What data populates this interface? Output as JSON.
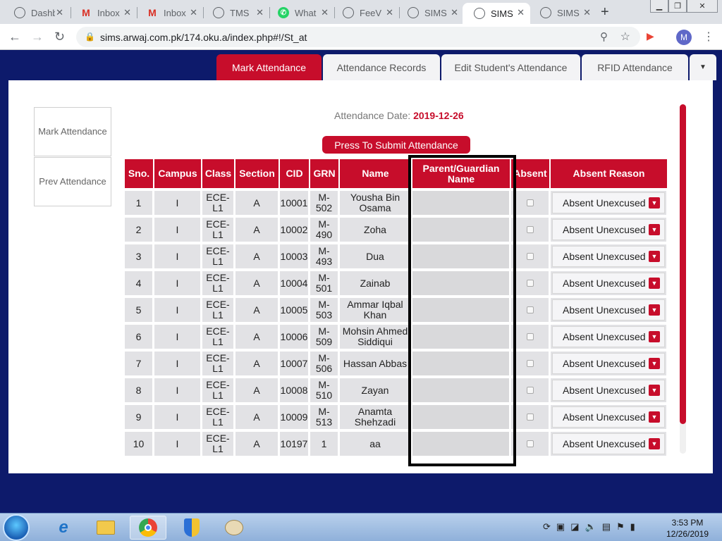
{
  "browser": {
    "tabs": [
      {
        "title": "Dashb",
        "icon": "globe-icon"
      },
      {
        "title": "Inbox",
        "icon": "gmail-icon"
      },
      {
        "title": "Inbox",
        "icon": "gmail-icon"
      },
      {
        "title": "TMS",
        "icon": "globe-icon"
      },
      {
        "title": "What",
        "icon": "whatsapp-icon"
      },
      {
        "title": "FeeV",
        "icon": "globe-icon"
      },
      {
        "title": "SIMS",
        "icon": "globe-icon"
      },
      {
        "title": "SIMS",
        "icon": "globe-icon",
        "active": true
      },
      {
        "title": "SIMS",
        "icon": "globe-icon"
      }
    ],
    "url": "sims.arwaj.com.pk/174.oku.a/index.php#!/St_at",
    "profile_initial": "M"
  },
  "page_tabs": [
    {
      "label": "Mark Attendance",
      "active": true
    },
    {
      "label": "Attendance Records"
    },
    {
      "label": "Edit Student's Attendance"
    },
    {
      "label": "RFID Attendance"
    }
  ],
  "sidebar": {
    "mark_attendance": "Mark Attendance",
    "prev_attendance": "Prev Attendance"
  },
  "attendance": {
    "date_label": "Attendance Date:",
    "date_value": "2019-12-26",
    "submit_label": "Press To Submit Attendance",
    "columns": [
      "Sno.",
      "Campus",
      "Class",
      "Section",
      "CID",
      "GRN",
      "Name",
      "Parent/Guardian Name",
      "Absent",
      "Absent Reason"
    ],
    "rows": [
      {
        "sno": "1",
        "campus": "I",
        "class": "ECE-L1",
        "section": "A",
        "cid": "10001",
        "grn": "M-502",
        "name": "Yousha Bin Osama",
        "guardian": "",
        "reason": "Absent Unexcused"
      },
      {
        "sno": "2",
        "campus": "I",
        "class": "ECE-L1",
        "section": "A",
        "cid": "10002",
        "grn": "M-490",
        "name": "Zoha",
        "guardian": "",
        "reason": "Absent Unexcused"
      },
      {
        "sno": "3",
        "campus": "I",
        "class": "ECE-L1",
        "section": "A",
        "cid": "10003",
        "grn": "M-493",
        "name": "Dua",
        "guardian": "",
        "reason": "Absent Unexcused"
      },
      {
        "sno": "4",
        "campus": "I",
        "class": "ECE-L1",
        "section": "A",
        "cid": "10004",
        "grn": "M-501",
        "name": "Zainab",
        "guardian": "",
        "reason": "Absent Unexcused"
      },
      {
        "sno": "5",
        "campus": "I",
        "class": "ECE-L1",
        "section": "A",
        "cid": "10005",
        "grn": "M-503",
        "name": "Ammar Iqbal Khan",
        "guardian": "",
        "reason": "Absent Unexcused"
      },
      {
        "sno": "6",
        "campus": "I",
        "class": "ECE-L1",
        "section": "A",
        "cid": "10006",
        "grn": "M-509",
        "name": "Mohsin Ahmed Siddiqui",
        "guardian": "",
        "reason": "Absent Unexcused"
      },
      {
        "sno": "7",
        "campus": "I",
        "class": "ECE-L1",
        "section": "A",
        "cid": "10007",
        "grn": "M-506",
        "name": "Hassan Abbas",
        "guardian": "",
        "reason": "Absent Unexcused"
      },
      {
        "sno": "8",
        "campus": "I",
        "class": "ECE-L1",
        "section": "A",
        "cid": "10008",
        "grn": "M-510",
        "name": "Zayan",
        "guardian": "",
        "reason": "Absent Unexcused"
      },
      {
        "sno": "9",
        "campus": "I",
        "class": "ECE-L1",
        "section": "A",
        "cid": "10009",
        "grn": "M-513",
        "name": "Anamta Shehzadi",
        "guardian": "",
        "reason": "Absent Unexcused"
      },
      {
        "sno": "10",
        "campus": "I",
        "class": "ECE-L1",
        "section": "A",
        "cid": "10197",
        "grn": "1",
        "name": "aa",
        "guardian": "",
        "reason": "Absent Unexcused"
      }
    ]
  },
  "taskbar": {
    "clock_time": "3:53 PM",
    "clock_date": "12/26/2019"
  },
  "colors": {
    "brand": "#c70d2b",
    "page_background": "#0d1a6b"
  }
}
